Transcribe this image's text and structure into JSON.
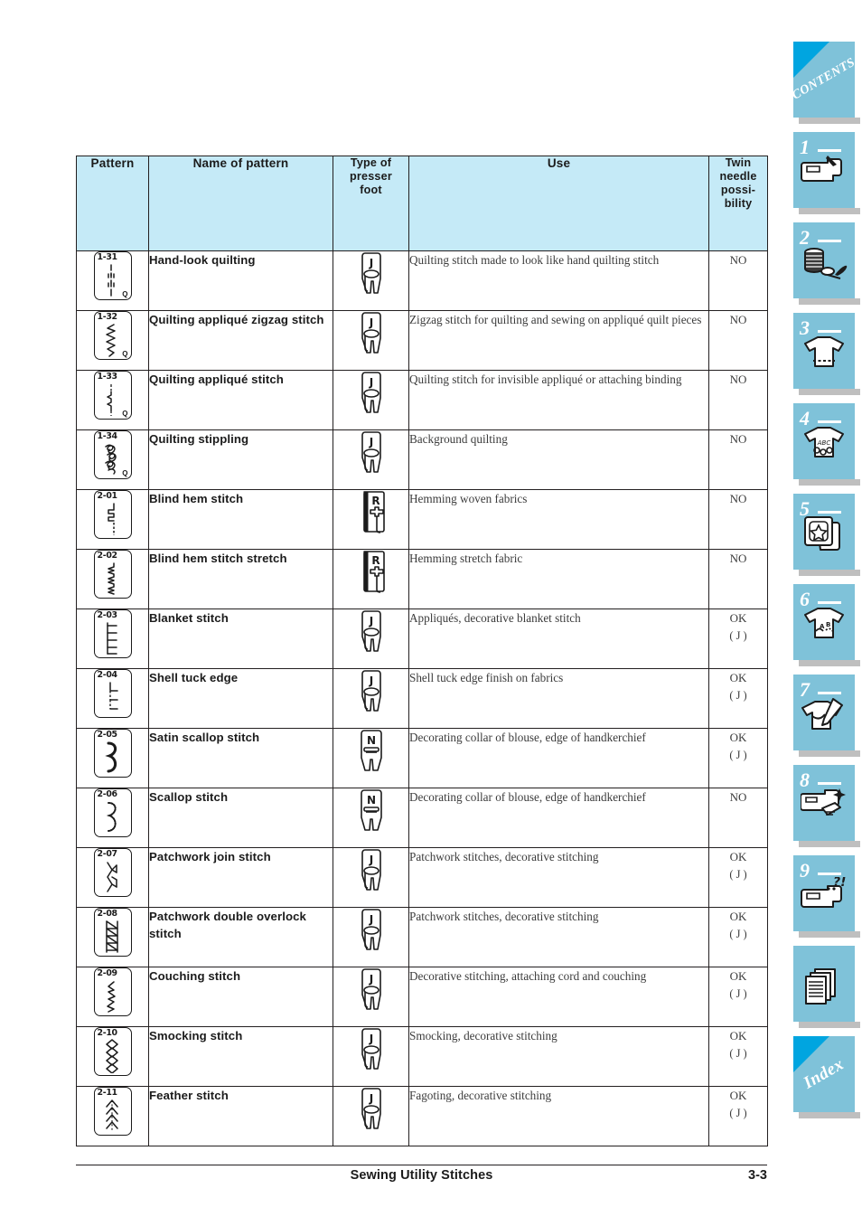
{
  "document": {
    "footer_title": "Sewing Utility Stitches",
    "footer_page": "3-3"
  },
  "colors": {
    "table_header_bg": "#c5eaf7",
    "tab_bg": "#7fc2d9",
    "tab_fold": "#00a5e0",
    "tab_shadow": "#bfbfbf",
    "rule": "#231f20"
  },
  "table": {
    "headers": {
      "pattern": "Pattern",
      "name": "Name of pattern",
      "foot": "Type of\npresser\nfoot",
      "foot_line1": "Type of",
      "foot_line2": "presser",
      "foot_line3": "foot",
      "use": "Use",
      "twin_line1": "Twin",
      "twin_line2": "needle",
      "twin_line3": "possi-",
      "twin_line4": "bility"
    },
    "rows": [
      {
        "pattern_id": "1-31",
        "pattern_q": "Q",
        "pattern_art": "hand-look-quilting-stitch-art",
        "name": "Hand-look quilting",
        "foot": "J",
        "foot_icon": "presser-foot-j-icon",
        "use": "Quilting stitch made to look like hand quilting stitch",
        "twin": "NO",
        "twin_sub": ""
      },
      {
        "pattern_id": "1-32",
        "pattern_q": "Q",
        "pattern_art": "quilting-applique-zigzag-art",
        "name": "Quilting appliqué zigzag stitch",
        "foot": "J",
        "foot_icon": "presser-foot-j-icon",
        "use": "Zigzag stitch for quilting and sewing on appliqué quilt pieces",
        "twin": "NO",
        "twin_sub": ""
      },
      {
        "pattern_id": "1-33",
        "pattern_q": "Q",
        "pattern_art": "quilting-applique-stitch-art",
        "name": "Quilting appliqué stitch",
        "foot": "J",
        "foot_icon": "presser-foot-j-icon",
        "use": "Quilting stitch for invisible appliqué or attaching binding",
        "twin": "NO",
        "twin_sub": ""
      },
      {
        "pattern_id": "1-34",
        "pattern_q": "Q",
        "pattern_art": "quilting-stippling-art",
        "name": "Quilting stippling",
        "foot": "J",
        "foot_icon": "presser-foot-j-icon",
        "use": "Background quilting",
        "twin": "NO",
        "twin_sub": ""
      },
      {
        "pattern_id": "2-01",
        "pattern_q": "",
        "pattern_art": "blind-hem-stitch-art",
        "name": "Blind hem stitch",
        "foot": "R",
        "foot_icon": "presser-foot-r-icon",
        "use": "Hemming woven fabrics",
        "twin": "NO",
        "twin_sub": ""
      },
      {
        "pattern_id": "2-02",
        "pattern_q": "",
        "pattern_art": "blind-hem-stretch-art",
        "name": "Blind hem stitch stretch",
        "foot": "R",
        "foot_icon": "presser-foot-r-icon",
        "use": "Hemming stretch fabric",
        "twin": "NO",
        "twin_sub": ""
      },
      {
        "pattern_id": "2-03",
        "pattern_q": "",
        "pattern_art": "blanket-stitch-art",
        "name": "Blanket stitch",
        "foot": "J",
        "foot_icon": "presser-foot-j-icon",
        "use": "Appliqués, decorative blanket stitch",
        "twin": "OK",
        "twin_sub": "( J )"
      },
      {
        "pattern_id": "2-04",
        "pattern_q": "",
        "pattern_art": "shell-tuck-edge-art",
        "name": "Shell tuck edge",
        "foot": "J",
        "foot_icon": "presser-foot-j-icon",
        "use": "Shell tuck edge finish on fabrics",
        "twin": "OK",
        "twin_sub": "( J )"
      },
      {
        "pattern_id": "2-05",
        "pattern_q": "",
        "pattern_art": "satin-scallop-art",
        "name": "Satin scallop stitch",
        "foot": "N",
        "foot_icon": "presser-foot-n-icon",
        "use": "Decorating collar of blouse, edge of handkerchief",
        "twin": "OK",
        "twin_sub": "( J )"
      },
      {
        "pattern_id": "2-06",
        "pattern_q": "",
        "pattern_art": "scallop-stitch-art",
        "name": "Scallop stitch",
        "foot": "N",
        "foot_icon": "presser-foot-n-icon",
        "use": "Decorating collar of blouse, edge of handkerchief",
        "twin": "NO",
        "twin_sub": ""
      },
      {
        "pattern_id": "2-07",
        "pattern_q": "",
        "pattern_art": "patchwork-join-art",
        "name": "Patchwork join stitch",
        "foot": "J",
        "foot_icon": "presser-foot-j-icon",
        "use": "Patchwork stitches, decorative stitching",
        "twin": "OK",
        "twin_sub": "( J )"
      },
      {
        "pattern_id": "2-08",
        "pattern_q": "",
        "pattern_art": "patchwork-double-overlock-art",
        "name": "Patchwork double overlock stitch",
        "foot": "J",
        "foot_icon": "presser-foot-j-icon",
        "use": "Patchwork stitches, decorative stitching",
        "twin": "OK",
        "twin_sub": "( J )"
      },
      {
        "pattern_id": "2-09",
        "pattern_q": "",
        "pattern_art": "couching-stitch-art",
        "name": "Couching stitch",
        "foot": "J",
        "foot_icon": "presser-foot-j-icon",
        "use": "Decorative stitching, attaching cord and couching",
        "twin": "OK",
        "twin_sub": "( J )"
      },
      {
        "pattern_id": "2-10",
        "pattern_q": "",
        "pattern_art": "smocking-stitch-art",
        "name": "Smocking stitch",
        "foot": "J",
        "foot_icon": "presser-foot-j-icon",
        "use": "Smocking, decorative stitching",
        "twin": "OK",
        "twin_sub": "( J )"
      },
      {
        "pattern_id": "2-11",
        "pattern_q": "",
        "pattern_art": "feather-stitch-art",
        "name": "Feather stitch",
        "foot": "J",
        "foot_icon": "presser-foot-j-icon",
        "use": "Fagoting, decorative stitching",
        "twin": "OK",
        "twin_sub": "( J )"
      }
    ]
  },
  "side_tabs": [
    {
      "kind": "corner",
      "label": "CONTENTS",
      "name": "contents"
    },
    {
      "kind": "chapter",
      "num": "1",
      "icon": "sewing-machine-icon",
      "name": "chapter-1"
    },
    {
      "kind": "chapter",
      "num": "2",
      "icon": "thread-spool-icon",
      "name": "chapter-2"
    },
    {
      "kind": "chapter",
      "num": "3",
      "icon": "shirt-hem-icon",
      "name": "chapter-3"
    },
    {
      "kind": "chapter",
      "num": "4",
      "icon": "shirt-abc-embroidery-icon",
      "name": "chapter-4"
    },
    {
      "kind": "chapter",
      "num": "5",
      "icon": "embroidery-card-icon",
      "name": "chapter-5"
    },
    {
      "kind": "chapter",
      "num": "6",
      "icon": "shirt-lettering-icon",
      "name": "chapter-6"
    },
    {
      "kind": "chapter",
      "num": "7",
      "icon": "shirt-pen-edit-icon",
      "name": "chapter-7"
    },
    {
      "kind": "chapter",
      "num": "8",
      "icon": "machine-maintenance-icon",
      "name": "chapter-8"
    },
    {
      "kind": "chapter",
      "num": "9",
      "icon": "machine-troubleshoot-icon",
      "name": "chapter-9"
    },
    {
      "kind": "plain",
      "icon": "appendix-pages-icon",
      "name": "appendix"
    },
    {
      "kind": "corner",
      "label": "Index",
      "name": "index"
    }
  ]
}
